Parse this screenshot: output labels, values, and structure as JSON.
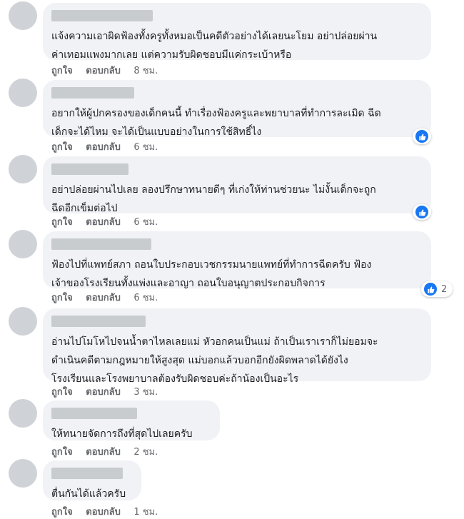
{
  "comments": [
    {
      "text": "แจ้งความเอาผิดฟ้องทั้งครูทั้งหมอเป็นคดีตัวอย่างได้เลยนะโยม อย่าปล่อยผ่าน\nค่าเทอมแพงมากเลย แต่ความรับผิดชอบมีแค่กระเบ้าหรือ",
      "like": "ถูกใจ",
      "reply": "ตอบกลับ",
      "time": "8 ชม."
    },
    {
      "text": "อยากให้ผู้ปกครองของเด็กคนนี้ ทำเรื่องฟ้องครูและพยาบาลที่ทำการละเมิด ฉีด\nเด็กจะได้ไหม จะได้เป็นแบบอย่างในการใช้สิทธิ์ไง",
      "like": "ถูกใจ",
      "reply": "ตอบกลับ",
      "time": "6 ชม.",
      "reaction_icon": "like-icon"
    },
    {
      "text": "อย่าปล่อยผ่านไปเลย ลองปรึกษาทนายดีๆ ที่เก่งให้ท่านช่วยนะ ไม่งั้นเด็กจะถูก\nฉีดอีกเข็มต่อไป",
      "like": "ถูกใจ",
      "reply": "ตอบกลับ",
      "time": "6 ชม.",
      "reaction_icon": "like-icon"
    },
    {
      "text": "ฟ้องไปที่แพทย์สภา ถอนใบประกอบเวชกรรมนายแพทย์ที่ทำการฉีดครับ ฟ้อง\nเจ้าของโรงเรียนทั้งแพ่งและอาญา ถอนใบอนุญาตประกอบกิจการ",
      "like": "ถูกใจ",
      "reply": "ตอบกลับ",
      "time": "6 ชม.",
      "reaction_icon": "like-icon",
      "reaction_count": "2"
    },
    {
      "text": "อ่านไปโมโหไปจนน้ำตาไหลเลยแม่ หัวอกคนเป็นแม่ ถ้าเป็นเราเราก็ไม่ยอมจะ\nดำเนินคดีตามกฎหมายให้สูงสุด แม่บอกแล้วบอกอีกยังผิดพลาดได้ยังไง\nโรงเรียนและโรงพยาบาลต้องรับผิดชอบค่ะถ้าน้องเป็นอะไร",
      "like": "ถูกใจ",
      "reply": "ตอบกลับ",
      "time": "3 ชม."
    },
    {
      "text": "ให้ทนายจัดการถึงที่สุดไปเลยครับ",
      "like": "ถูกใจ",
      "reply": "ตอบกลับ",
      "time": "2 ชม."
    },
    {
      "text": "ตื่นกันได้แล้วครับ",
      "like": "ถูกใจ",
      "reply": "ตอบกลับ",
      "time": "1 ชม."
    }
  ],
  "colors": {
    "bubble": "#f0f2f5",
    "text": "#1c1e21",
    "meta": "#65676b",
    "like_blue": "#1877f2",
    "avatar": "#cfd2d6",
    "redaction": "#c9cccf"
  }
}
